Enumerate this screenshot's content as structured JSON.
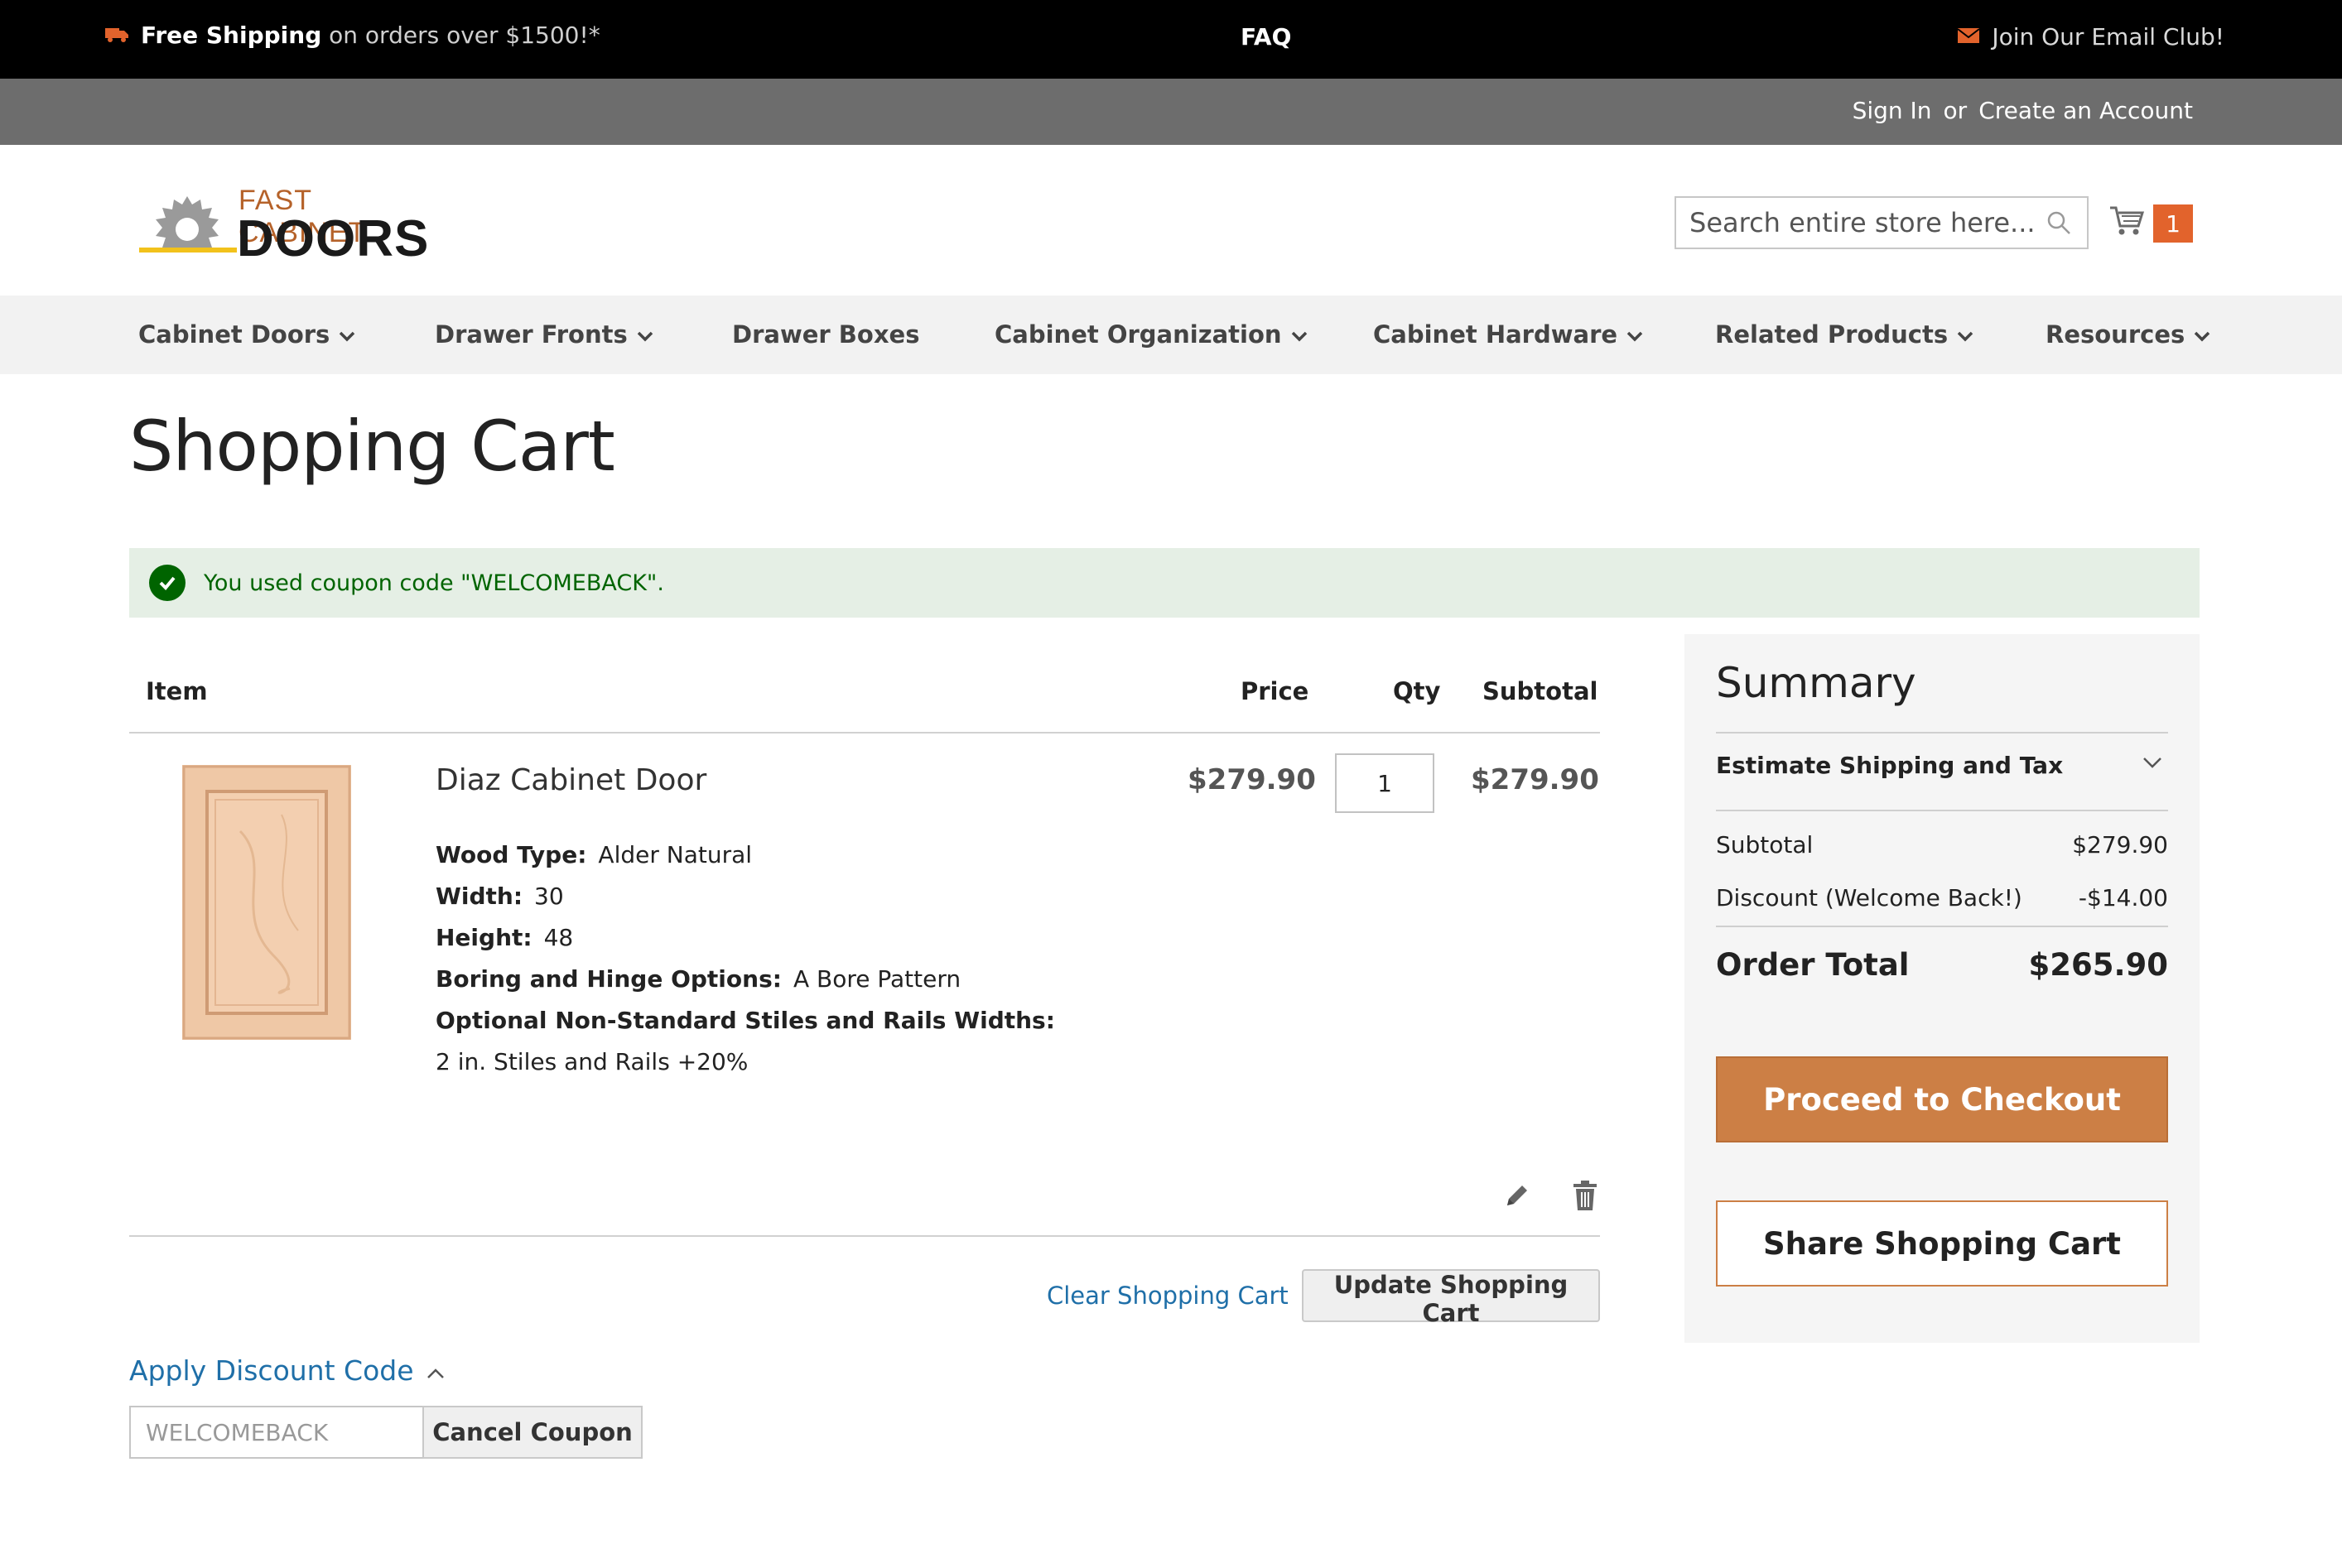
{
  "topbar": {
    "shipping_bold": "Free Shipping",
    "shipping_rest": "on orders over $1500!*",
    "faq": "FAQ",
    "email_club": "Join Our Email Club!"
  },
  "account": {
    "sign_in": "Sign In",
    "or": "or",
    "create_account": "Create an Account"
  },
  "logo": {
    "line1": "FAST CABINET",
    "line2": "DOORS"
  },
  "search": {
    "placeholder": "Search entire store here..."
  },
  "cart": {
    "count": "1"
  },
  "nav": [
    {
      "label": "Cabinet Doors",
      "has_dropdown": true
    },
    {
      "label": "Drawer Fronts",
      "has_dropdown": true
    },
    {
      "label": "Drawer Boxes",
      "has_dropdown": false
    },
    {
      "label": "Cabinet Organization",
      "has_dropdown": true
    },
    {
      "label": "Cabinet Hardware",
      "has_dropdown": true
    },
    {
      "label": "Related Products",
      "has_dropdown": true
    },
    {
      "label": "Resources",
      "has_dropdown": true
    }
  ],
  "page": {
    "title": "Shopping Cart"
  },
  "message": {
    "text": "You used coupon code \"WELCOMEBACK\"."
  },
  "table": {
    "headers": {
      "item": "Item",
      "price": "Price",
      "qty": "Qty",
      "subtotal": "Subtotal"
    }
  },
  "item": {
    "name": "Diaz Cabinet Door",
    "options": [
      {
        "label": "Wood Type:",
        "value": "Alder Natural"
      },
      {
        "label": "Width:",
        "value": "30"
      },
      {
        "label": "Height:",
        "value": "48"
      },
      {
        "label": "Boring and Hinge Options:",
        "value": "A Bore Pattern"
      },
      {
        "label": "Optional Non-Standard Stiles and Rails Widths:",
        "value": ""
      }
    ],
    "extra_line": "2 in. Stiles and Rails +20%",
    "price": "$279.90",
    "qty": "1",
    "subtotal": "$279.90"
  },
  "actions": {
    "clear_cart": "Clear Shopping Cart",
    "update_cart": "Update Shopping Cart"
  },
  "discount": {
    "toggle_label": "Apply Discount Code",
    "code_value": "WELCOMEBACK",
    "cancel_label": "Cancel Coupon"
  },
  "summary": {
    "title": "Summary",
    "estimate_label": "Estimate Shipping and Tax",
    "subtotal_label": "Subtotal",
    "subtotal_value": "$279.90",
    "discount_label": "Discount (Welcome Back!)",
    "discount_value": "-$14.00",
    "total_label": "Order Total",
    "total_value": "$265.90",
    "checkout_label": "Proceed to Checkout",
    "share_label": "Share Shopping Cart"
  },
  "colors": {
    "accent": "#cc7f45",
    "badge": "#e2632c",
    "success": "#006400",
    "link": "#1f6fa8"
  }
}
